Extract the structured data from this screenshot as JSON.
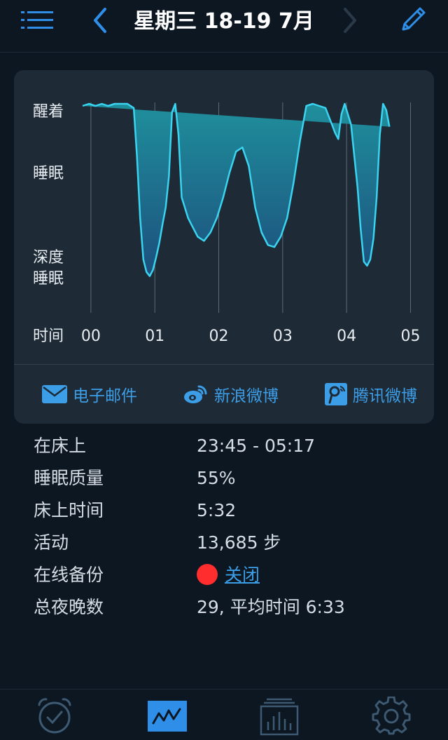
{
  "header": {
    "title": "星期三 18-19 7月",
    "icons": {
      "menu": "menu-icon",
      "back": "chevron-left-icon",
      "forward": "chevron-right-icon",
      "edit": "pencil-icon"
    },
    "accent": "#2f8fe8"
  },
  "chart_data": {
    "type": "area",
    "y_levels": [
      "醒着",
      "睡眠",
      "深度\n睡眠"
    ],
    "y_label_lines": {
      "awake": "醒着",
      "sleep": "睡眠",
      "deep1": "深度",
      "deep2": "睡眠"
    },
    "xlabel": "时间",
    "x_ticks": [
      "00",
      "01",
      "02",
      "03",
      "04",
      "05"
    ],
    "xlim": [
      0,
      5.3
    ],
    "ylim": [
      0,
      1
    ],
    "grid": true,
    "line_color": "#3ad3f0",
    "x": [
      0,
      0.1,
      0.2,
      0.3,
      0.4,
      0.5,
      0.6,
      0.7,
      0.8,
      0.85,
      0.9,
      0.95,
      1.0,
      1.05,
      1.1,
      1.15,
      1.2,
      1.25,
      1.3,
      1.35,
      1.4,
      1.45,
      1.5,
      1.55,
      1.6,
      1.65,
      1.7,
      1.8,
      1.9,
      2.0,
      2.1,
      2.2,
      2.3,
      2.4,
      2.5,
      2.6,
      2.7,
      2.8,
      2.9,
      3.0,
      3.1,
      3.2,
      3.3,
      3.4,
      3.5,
      3.6,
      3.7,
      3.8,
      3.9,
      3.95,
      4.0,
      4.05,
      4.1,
      4.2,
      4.3,
      4.35,
      4.4,
      4.45,
      4.5,
      4.55,
      4.6,
      4.65,
      4.7,
      4.75,
      4.8,
      4.85,
      4.9,
      4.95,
      5.0,
      5.05,
      5.1,
      5.15,
      5.2,
      5.25,
      5.3
    ],
    "values": [
      0.99,
      1.0,
      0.99,
      1.0,
      0.99,
      1.0,
      1.0,
      1.0,
      0.98,
      0.75,
      0.45,
      0.25,
      0.19,
      0.17,
      0.2,
      0.26,
      0.33,
      0.42,
      0.5,
      0.65,
      0.96,
      1.0,
      0.85,
      0.55,
      0.5,
      0.45,
      0.42,
      0.36,
      0.34,
      0.38,
      0.45,
      0.55,
      0.67,
      0.77,
      0.79,
      0.7,
      0.5,
      0.38,
      0.32,
      0.31,
      0.36,
      0.45,
      0.62,
      0.82,
      0.99,
      1.0,
      0.99,
      0.98,
      0.9,
      0.86,
      0.83,
      0.95,
      1.0,
      0.9,
      0.6,
      0.4,
      0.24,
      0.22,
      0.25,
      0.35,
      0.55,
      0.85,
      1.0,
      0.97,
      0.89
    ]
  },
  "share": {
    "email": "电子邮件",
    "weibo": "新浪微博",
    "tencent": "腾讯微博",
    "icons": [
      "mail-icon",
      "weibo-icon",
      "tencent-weibo-icon"
    ]
  },
  "stats": [
    {
      "label": "在床上",
      "value": "23:45 - 05:17"
    },
    {
      "label": "睡眠质量",
      "value": "55%"
    },
    {
      "label": "床上时间",
      "value": "5:32"
    },
    {
      "label": "活动",
      "value": "13,685 步"
    },
    {
      "label": "在线备份",
      "value": "关闭",
      "status_color": "#ff2d2d"
    },
    {
      "label": "总夜晚数",
      "value": "29, 平均时间 6:33"
    }
  ],
  "tabbar": {
    "icons": [
      "alarm-clock-icon",
      "sleep-graph-icon",
      "statistics-icon",
      "settings-gear-icon"
    ],
    "active": "sleep-graph-icon"
  }
}
